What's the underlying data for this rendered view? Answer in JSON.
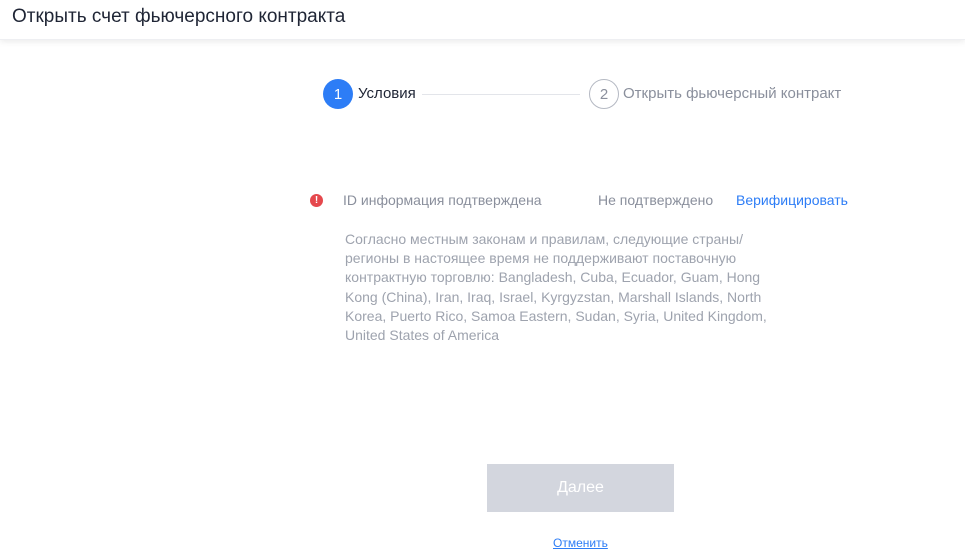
{
  "header": {
    "title": "Открыть счет фьючерсного контракта"
  },
  "steps": [
    {
      "number": "1",
      "label": "Условия",
      "active": true
    },
    {
      "number": "2",
      "label": "Открыть фьючерсный контракт",
      "active": false
    }
  ],
  "verification": {
    "icon": "alert-icon",
    "icon_glyph": "!",
    "icon_color": "#e5484d",
    "label": "ID информация подтверждена",
    "status": "Не подтверждено",
    "action": "Верифицировать"
  },
  "notice": {
    "text": "Согласно местным законам и правилам, следующие страны/регионы в настоящее время не поддерживают поставочную контрактную торговлю: Bangladesh, Cuba, Ecuador, Guam, Hong Kong (China), Iran, Iraq, Israel, Kyrgyzstan, Marshall Islands, North Korea, Puerto Rico, Samoa Eastern, Sudan, Syria, United Kingdom, United States of America"
  },
  "actions": {
    "next_label": "Далее",
    "cancel_label": "Отменить"
  },
  "colors": {
    "accent": "#2d7df6",
    "disabled_button": "#d3d6de",
    "error": "#e5484d"
  }
}
